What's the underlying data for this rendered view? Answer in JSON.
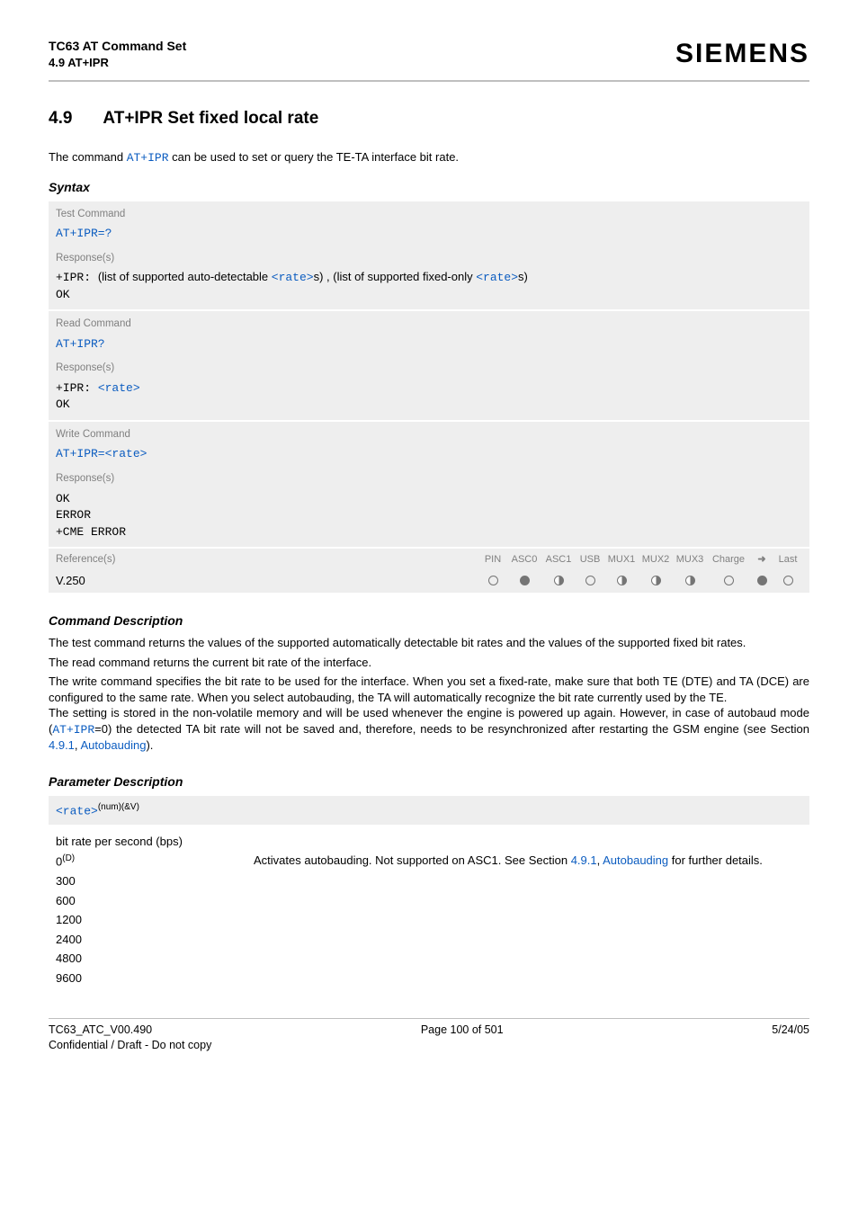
{
  "header": {
    "title": "TC63 AT Command Set",
    "subtitle": "4.9 AT+IPR",
    "brand": "SIEMENS"
  },
  "section": {
    "number": "4.9",
    "title": "AT+IPR   Set fixed local rate"
  },
  "lead": {
    "pre": "The command ",
    "cmd": "AT+IPR",
    "post": " can be used to set or query the TE-TA interface bit rate."
  },
  "syntax_heading": "Syntax",
  "test_cmd": {
    "label": "Test Command",
    "line": "AT+IPR=?",
    "resp_label": "Response(s)",
    "resp_prefix": "+IPR: ",
    "resp_mid1": "(list of supported auto-detectable ",
    "rate_token": "<rate>",
    "resp_mid2": "s) , (list of supported fixed-only ",
    "resp_mid3": "s)",
    "ok": "OK"
  },
  "read_cmd": {
    "label": "Read Command",
    "line": "AT+IPR?",
    "resp_label": "Response(s)",
    "resp_prefix": "+IPR: ",
    "rate_token": "<rate>",
    "ok": "OK"
  },
  "write_cmd": {
    "label": "Write Command",
    "line_pre": "AT+IPR=",
    "rate_token": "<rate>",
    "resp_label": "Response(s)",
    "ok": "OK",
    "error": "ERROR",
    "cme": "+CME ERROR"
  },
  "refs": {
    "label": "Reference(s)",
    "cols": [
      "PIN",
      "ASC0",
      "ASC1",
      "USB",
      "MUX1",
      "MUX2",
      "MUX3",
      "Charge",
      "➜",
      "Last"
    ],
    "name": "V.250"
  },
  "cmd_desc_heading": "Command Description",
  "cmd_desc": {
    "p1": "The test command returns the values of the supported automatically detectable bit rates and the values of the supported fixed bit rates.",
    "p2": "The read command returns the current bit rate of the interface.",
    "p3a": "The write command specifies the bit rate to be used for the interface. When you set a fixed-rate, make sure that both TE (DTE) and TA (DCE) are configured to the same rate. When you select autobauding, the TA will automatically recognize the bit rate currently used by the TE.",
    "p3b_pre": "The setting is stored in the non-volatile memory and will be used whenever the engine is powered up again. However, in case of autobaud mode (",
    "p3b_cmd": "AT+IPR",
    "p3b_mid": "=0) the detected TA bit rate will not be saved and, therefore, needs to be resynchronized after restarting the GSM engine (see Section ",
    "p3b_link1": "4.9.1",
    "p3b_comma": ", ",
    "p3b_link2": "Autobauding",
    "p3b_end": ")."
  },
  "param_heading": "Parameter Description",
  "param": {
    "token": "<rate>",
    "sup": "(num)(&V)",
    "label": "bit rate per second (bps)",
    "row0": {
      "val": "0",
      "sup": "(D)",
      "desc_pre": "Activates autobauding. Not supported on ASC1. See Section ",
      "link1": "4.9.1",
      "mid": ", ",
      "link2": "Autobauding",
      "desc_post": " for further details."
    },
    "vals": [
      "300",
      "600",
      "1200",
      "2400",
      "4800",
      "9600"
    ]
  },
  "footer": {
    "left": "TC63_ATC_V00.490",
    "center": "Page 100 of 501",
    "right": "5/24/05",
    "conf": "Confidential / Draft - Do not copy"
  }
}
